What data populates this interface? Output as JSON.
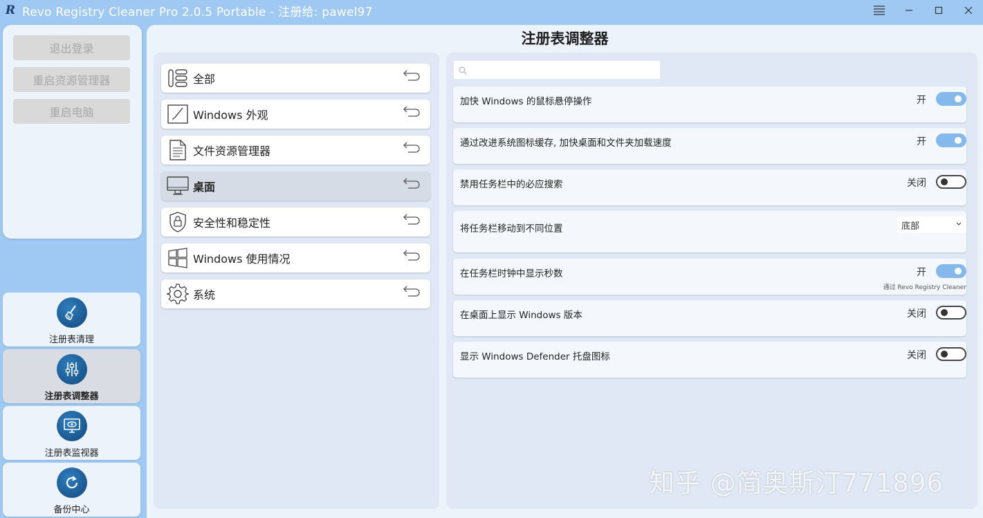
{
  "window": {
    "title": "Revo Registry Cleaner Pro 2.0.5 Portable - 注册给: pawel97"
  },
  "left_actions": {
    "logout": "退出登录",
    "restart_explorer": "重启资源管理器",
    "restart_pc": "重启电脑"
  },
  "nav": [
    {
      "label": "注册表清理",
      "icon": "broom-icon"
    },
    {
      "label": "注册表调整器",
      "icon": "sliders-icon"
    },
    {
      "label": "注册表监视器",
      "icon": "monitor-eye-icon"
    },
    {
      "label": "备份中心",
      "icon": "restore-icon"
    }
  ],
  "main": {
    "title": "注册表调整器"
  },
  "categories": [
    {
      "label": "全部",
      "icon": "all-icon"
    },
    {
      "label": "Windows 外观",
      "icon": "brush-icon"
    },
    {
      "label": "文件资源管理器",
      "icon": "document-icon"
    },
    {
      "label": "桌面",
      "icon": "desktop-icon"
    },
    {
      "label": "安全性和稳定性",
      "icon": "shield-lock-icon"
    },
    {
      "label": "Windows 使用情况",
      "icon": "windows-icon"
    },
    {
      "label": "系统",
      "icon": "gear-icon"
    }
  ],
  "search": {
    "placeholder": ""
  },
  "settings": [
    {
      "label": "加快 Windows 的鼠标悬停操作",
      "state": "开",
      "on": true
    },
    {
      "label": "通过改进系统图标缓存, 加快桌面和文件夹加载速度",
      "state": "开",
      "on": true
    },
    {
      "label": "禁用任务栏中的必应搜索",
      "state": "关闭",
      "on": false
    },
    {
      "label": "将任务栏移动到不同位置",
      "select_value": "底部"
    },
    {
      "label": "在任务栏时钟中显示秒数",
      "state": "开",
      "on": true,
      "note": "通过 Revo Registry Cleaner"
    },
    {
      "label": "在桌面上显示 Windows 版本",
      "state": "关闭",
      "on": false
    },
    {
      "label": "显示 Windows Defender 托盘图标",
      "state": "关闭",
      "on": false
    }
  ],
  "watermark": "知乎 @简奥斯汀771896",
  "colors": {
    "background": "#9fc9f2",
    "toggle_on": "#85b9ec",
    "icon_blue": "#12467a"
  }
}
